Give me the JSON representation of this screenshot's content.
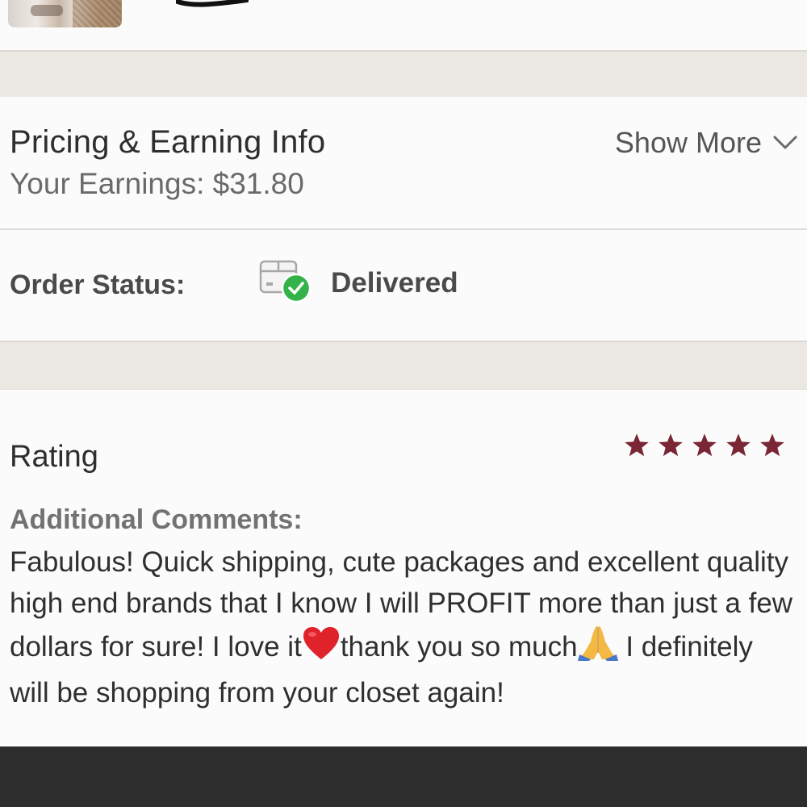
{
  "pricing": {
    "title": "Pricing & Earning Info",
    "earnings_text": "Your Earnings: $31.80",
    "show_more_label": "Show More",
    "chevron_icon": "chevron-down-icon"
  },
  "order": {
    "label": "Order Status:",
    "status": "Delivered",
    "status_icon": "package-delivered-icon",
    "status_color": "#34b24a"
  },
  "rating": {
    "label": "Rating",
    "stars": 5,
    "max_stars": 5,
    "star_color": "#7a2634"
  },
  "comments": {
    "label": "Additional Comments:",
    "text_part1": "Fabulous! Quick shipping, cute packages and excellent quality high end brands that I know I will PROFIT more than just a few dollars for sure! I love it",
    "emoji1": "❤️",
    "text_part2": "thank you so much",
    "emoji2": "🙏",
    "text_part3": " I definitely will be shopping from your closet again!"
  }
}
